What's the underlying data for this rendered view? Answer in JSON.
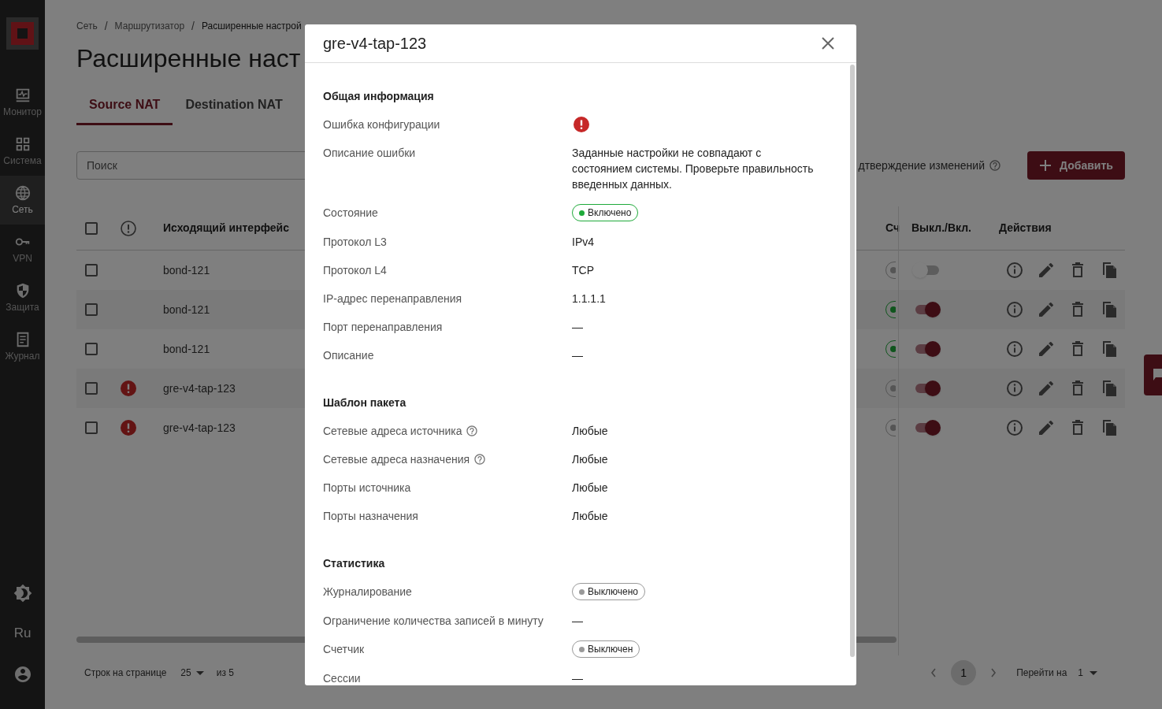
{
  "sidebar": {
    "items": [
      {
        "kind": "monitor",
        "label": "Монитор",
        "selected": false
      },
      {
        "kind": "system",
        "label": "Система",
        "selected": false
      },
      {
        "kind": "network",
        "label": "Сеть",
        "selected": true
      },
      {
        "kind": "vpn",
        "label": "VPN",
        "selected": false
      },
      {
        "kind": "shield",
        "label": "Защита",
        "selected": false
      },
      {
        "kind": "log",
        "label": "Журнал",
        "selected": false
      }
    ],
    "language": "Ru"
  },
  "breadcrumbs": [
    "Сеть",
    "Маршрутизатор",
    "Расширенные настрой"
  ],
  "breadcrumb_separator": "/",
  "page_title": "Расширенные наст",
  "tabs": [
    {
      "label": "Source NAT",
      "selected": true
    },
    {
      "label": "Destination NAT",
      "selected": false
    }
  ],
  "search": {
    "placeholder": "Поиск"
  },
  "confirm_label": "дтверждение изменений",
  "add_button": "Добавить",
  "table": {
    "all_checked": false,
    "columns": {
      "interface": "Исходящий интерфейс",
      "counter": "Сч",
      "toggle": "Выкл./Вкл.",
      "actions": "Действия"
    },
    "rows": [
      {
        "checked": false,
        "error": false,
        "interface": "bond-121",
        "status_on": false,
        "enabled": false
      },
      {
        "checked": false,
        "error": false,
        "interface": "bond-121",
        "status_on": true,
        "enabled": true
      },
      {
        "checked": false,
        "error": false,
        "interface": "bond-121",
        "status_on": true,
        "enabled": true
      },
      {
        "checked": false,
        "error": true,
        "interface": "gre-v4-tap-123",
        "status_on": false,
        "enabled": true
      },
      {
        "checked": false,
        "error": true,
        "interface": "gre-v4-tap-123",
        "status_on": false,
        "enabled": true
      }
    ]
  },
  "footer": {
    "rows_label": "Строк на странице",
    "rows_per_page": "25",
    "total": "из 5",
    "pages": [
      {
        "label": "1",
        "selected": true
      }
    ],
    "goto_label": "Перейти на",
    "goto_value": "1"
  },
  "modal": {
    "title": "gre-v4-tap-123",
    "sections": [
      {
        "title": "Общая информация",
        "rows": [
          {
            "label": "Ошибка конфигурации",
            "kind": "error"
          },
          {
            "label": "Описание ошибки",
            "kind": "text",
            "value": "Заданные настройки не совпадают с состоянием системы. Проверьте правильность введенных данных."
          },
          {
            "label": "Состояние",
            "kind": "badge",
            "value": "Включено",
            "on": true
          },
          {
            "label": "Протокол L3",
            "kind": "text",
            "value": "IPv4"
          },
          {
            "label": "Протокол L4",
            "kind": "text",
            "value": "TCP"
          },
          {
            "label": "IP-адрес перенаправления",
            "kind": "text",
            "value": "1.1.1.1"
          },
          {
            "label": "Порт перенаправления",
            "kind": "text",
            "value": "—"
          },
          {
            "label": "Описание",
            "kind": "text",
            "value": "—"
          }
        ]
      },
      {
        "title": "Шаблон пакета",
        "rows": [
          {
            "label": "Сетевые адреса источника",
            "kind": "text",
            "value": "Любые",
            "help": true
          },
          {
            "label": "Сетевые адреса назначения",
            "kind": "text",
            "value": "Любые",
            "help": true
          },
          {
            "label": "Порты источника",
            "kind": "text",
            "value": "Любые"
          },
          {
            "label": "Порты назначения",
            "kind": "text",
            "value": "Любые"
          }
        ]
      },
      {
        "title": "Статистика",
        "rows": [
          {
            "label": "Журналирование",
            "kind": "badge",
            "value": "Выключено",
            "on": false
          },
          {
            "label": "Ограничение количества записей в минуту",
            "kind": "text",
            "value": "—"
          },
          {
            "label": "Счетчик",
            "kind": "badge",
            "value": "Выключен",
            "on": false
          },
          {
            "label": "Сессии",
            "kind": "text",
            "value": "—"
          }
        ]
      }
    ]
  }
}
